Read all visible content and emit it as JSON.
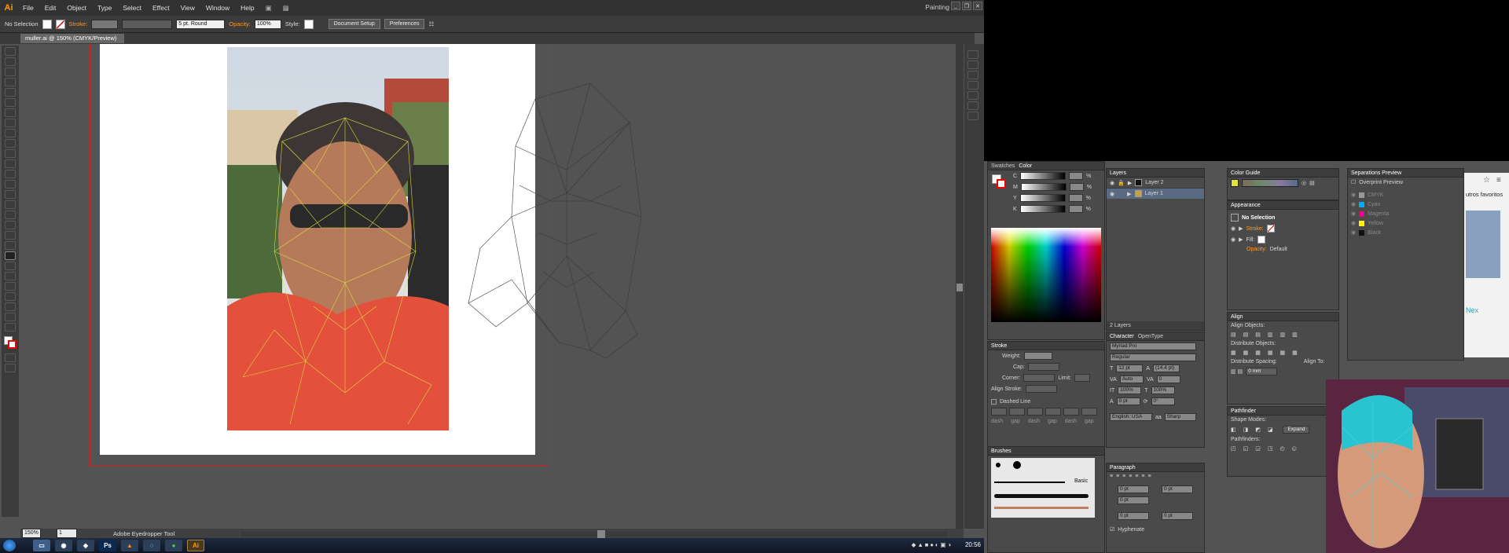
{
  "menubar": {
    "logo": "Ai",
    "items": [
      "File",
      "Edit",
      "Object",
      "Type",
      "Select",
      "Effect",
      "View",
      "Window",
      "Help"
    ],
    "workspace": "Painting"
  },
  "control": {
    "selection": "No Selection",
    "stroke_label": "Stroke:",
    "brush_value": "5 pt. Round",
    "opacity_label": "Opacity:",
    "opacity_value": "100%",
    "style_label": "Style:",
    "document_setup": "Document Setup",
    "preferences": "Preferences"
  },
  "document": {
    "tab_title": "muller.ai @ 150% (CMYK/Preview)"
  },
  "status": {
    "zoom": "150%",
    "page": "1",
    "tool": "Adobe Eyedropper Tool"
  },
  "colors": {
    "accent": "#ff9a00",
    "mesh": "#e0e040",
    "bleed": "#d42020"
  },
  "panels": {
    "swatches_tab": "Swatches",
    "color_tab": "Color",
    "color_channels": [
      "C",
      "M",
      "Y",
      "K"
    ],
    "percent": "%",
    "stroke": {
      "title": "Stroke",
      "weight": "Weight:",
      "cap": "Cap:",
      "corner": "Corner:",
      "limit": "Limit:",
      "align": "Align Stroke:",
      "dashed": "Dashed Line",
      "dash": "dash",
      "gap": "gap"
    },
    "brushes": {
      "title": "Brushes",
      "basic": "Basic"
    },
    "layers": {
      "title": "Layers",
      "items": [
        "Layer 2",
        "Layer 1"
      ],
      "count": "2 Layers"
    },
    "character": {
      "tab": "Character",
      "tab2": "OpenType",
      "font": "Myriad Pro",
      "style": "Regular",
      "size": "12 pt",
      "leading": "(14.4 pt)",
      "tracking_auto": "Auto",
      "kerning": "0",
      "hscale": "100%",
      "vscale": "100%",
      "baseline": "0 pt",
      "rotate": "0°",
      "language": "English: USA",
      "aa": "Sharp",
      "aa_label": "aa"
    },
    "paragraph": {
      "title": "Paragraph",
      "zero": "0 pt",
      "hyphenate": "Hyphenate"
    },
    "color_guide": {
      "title": "Color Guide"
    },
    "appearance": {
      "title": "Appearance",
      "selection": "No Selection",
      "stroke": "Stroke:",
      "fill": "Fill:",
      "opacity": "Opacity:",
      "opacity_val": "Default"
    },
    "align": {
      "title": "Align",
      "objects": "Align Objects:",
      "distribute": "Distribute Objects:",
      "spacing": "Distribute Spacing:",
      "align_to": "Align To:",
      "spacing_val": "0 mm"
    },
    "pathfinder": {
      "title": "Pathfinder",
      "shape_modes": "Shape Modes:",
      "expand": "Expand",
      "pathfinders": "Pathfinders:"
    },
    "separations": {
      "title": "Separations Preview",
      "overprint": "Overprint Preview",
      "items": [
        {
          "name": "CMYK",
          "color": "#999999"
        },
        {
          "name": "Cyan",
          "color": "#00aeef"
        },
        {
          "name": "Magenta",
          "color": "#ec008c"
        },
        {
          "name": "Yellow",
          "color": "#fff200"
        },
        {
          "name": "Black",
          "color": "#111111"
        }
      ]
    }
  },
  "browser": {
    "favorites": "utros favoritos",
    "partial": "Nex"
  },
  "taskbar": {
    "clock": "20:56"
  }
}
